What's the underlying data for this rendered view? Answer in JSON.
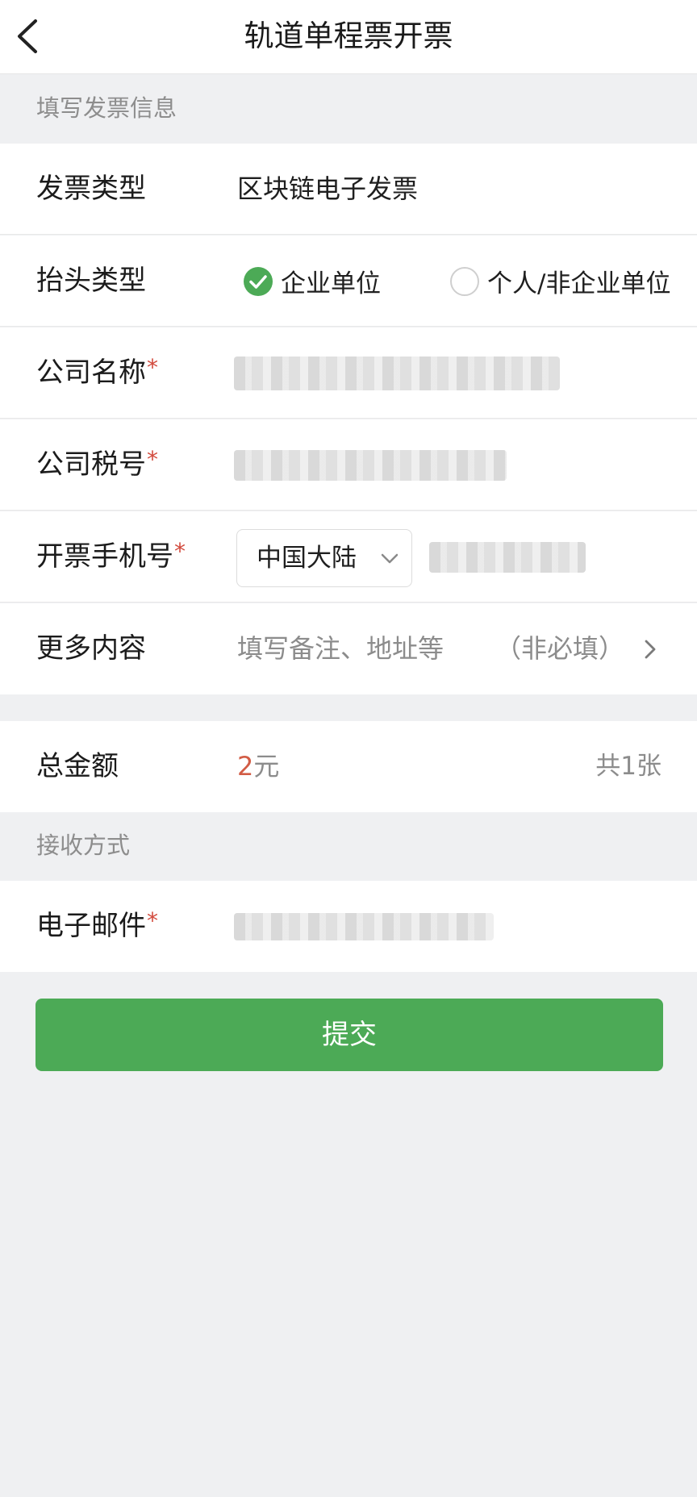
{
  "header": {
    "title": "轨道单程票开票"
  },
  "invoice_section": {
    "title": "填写发票信息"
  },
  "invoice_type": {
    "label": "发票类型",
    "value": "区块链电子发票"
  },
  "title_type": {
    "label": "抬头类型",
    "options": [
      {
        "label": "企业单位",
        "selected": true
      },
      {
        "label": "个人/非企业单位",
        "selected": false
      }
    ]
  },
  "company_name": {
    "label": "公司名称",
    "required_mark": "*"
  },
  "tax_id": {
    "label": "公司税号",
    "required_mark": "*"
  },
  "phone": {
    "label": "开票手机号",
    "required_mark": "*",
    "region": "中国大陆"
  },
  "more": {
    "label": "更多内容",
    "placeholder": "填写备注、地址等",
    "optional_note": "（非必填）"
  },
  "total": {
    "label": "总金额",
    "amount": "2",
    "unit": "元",
    "count": "共1张"
  },
  "receive_section": {
    "title": "接收方式"
  },
  "email": {
    "label": "电子邮件",
    "required_mark": "*"
  },
  "submit": {
    "label": "提交"
  },
  "colors": {
    "accent_green": "#4caa56",
    "required_red": "#d24a3d",
    "amount_red": "#d25c45",
    "background": "#eff0f2"
  },
  "icons": {
    "back": "chevron-left-icon",
    "checked": "check-circle-icon",
    "dropdown": "chevron-down-icon",
    "more": "chevron-right-icon"
  }
}
